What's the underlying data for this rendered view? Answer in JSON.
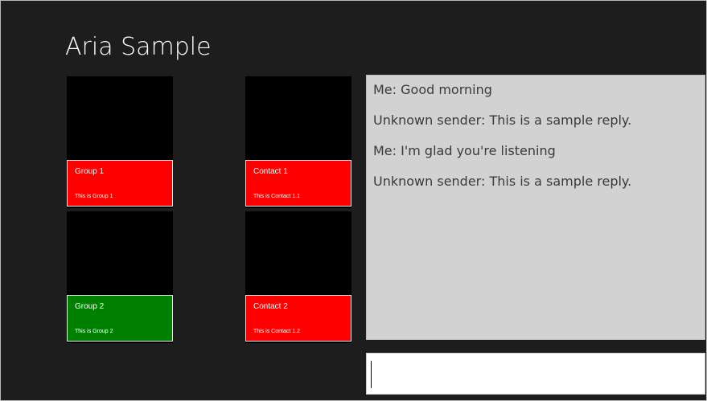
{
  "app": {
    "title": "Aria Sample"
  },
  "groups": [
    {
      "title": "Group 1",
      "subtitle": "This is Group 1",
      "color": "#ff0000"
    },
    {
      "title": "Group 2",
      "subtitle": "This is Group 2",
      "color": "#008000"
    }
  ],
  "contacts": [
    {
      "title": "Contact 1",
      "subtitle": "This is Contact 1.1",
      "color": "#ff0000"
    },
    {
      "title": "Contact 2",
      "subtitle": "This is Contact 1.2",
      "color": "#ff0000"
    }
  ],
  "chat": {
    "messages": [
      "Me: Good morning",
      "Unknown sender: This is a sample reply.",
      "Me: I'm glad you're listening",
      "Unknown sender: This is a sample reply."
    ]
  },
  "input": {
    "value": "",
    "placeholder": ""
  },
  "colors": {
    "background": "#1d1d1d",
    "chat_panel": "#d2d2d2",
    "tile_red": "#ff0000",
    "tile_green": "#008000"
  }
}
